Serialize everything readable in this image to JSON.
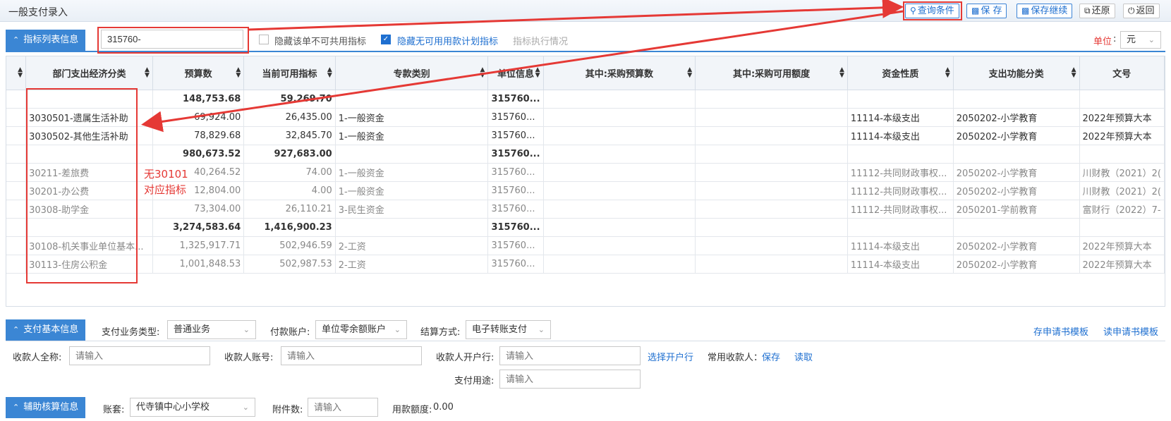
{
  "window": {
    "title": "一般支付录入"
  },
  "toolbar": {
    "query": "查询条件",
    "save": "保 存",
    "save_continue": "保存继续",
    "restore": "还原",
    "back": "返回"
  },
  "indicator_section": {
    "tab_label": "指标列表信息",
    "filter_value": "315760-",
    "hide_unshared_label": "隐藏该单不可共用指标",
    "hide_unshared_checked": false,
    "hide_unavailable_label": "隐藏无可用用款计划指标",
    "hide_unavailable_checked": true,
    "exec_status_label": "指标执行情况",
    "unit_label": "单位",
    "unit_value": "元"
  },
  "grid": {
    "columns": [
      "部门支出经济分类",
      "预算数",
      "当前可用指标",
      "专款类别",
      "单位信息",
      "其中:采购预算数",
      "其中:采购可用额度",
      "资金性质",
      "支出功能分类",
      "文号"
    ],
    "rows": [
      {
        "style": "bold",
        "cells": [
          "",
          "148,753.68",
          "59,269.70",
          "",
          "315760...",
          "",
          "",
          "",
          "",
          ""
        ]
      },
      {
        "style": "normal",
        "cells": [
          "3030501-遗属生活补助",
          "69,924.00",
          "26,435.00",
          "1-一般资金",
          "315760...",
          "",
          "",
          "11114-本级支出",
          "2050202-小学教育",
          "2022年预算大本"
        ]
      },
      {
        "style": "normal",
        "cells": [
          "3030502-其他生活补助",
          "78,829.68",
          "32,845.70",
          "1-一般资金",
          "315760...",
          "",
          "",
          "11114-本级支出",
          "2050202-小学教育",
          "2022年预算大本"
        ]
      },
      {
        "style": "bold",
        "cells": [
          "",
          "980,673.52",
          "927,683.00",
          "",
          "315760...",
          "",
          "",
          "",
          "",
          ""
        ]
      },
      {
        "style": "dim",
        "cells": [
          "30211-差旅费",
          "40,264.52",
          "74.00",
          "1-一般资金",
          "315760...",
          "",
          "",
          "11112-共同财政事权...",
          "2050202-小学教育",
          "川财教（2021）2("
        ]
      },
      {
        "style": "dim",
        "cells": [
          "30201-办公费",
          "12,804.00",
          "4.00",
          "1-一般资金",
          "315760...",
          "",
          "",
          "11112-共同财政事权...",
          "2050202-小学教育",
          "川财教（2021）2("
        ]
      },
      {
        "style": "dim",
        "cells": [
          "30308-助学金",
          "73,304.00",
          "26,110.21",
          "3-民生资金",
          "315760...",
          "",
          "",
          "11112-共同财政事权...",
          "2050201-学前教育",
          "富财行（2022）7-"
        ]
      },
      {
        "style": "bold",
        "cells": [
          "",
          "3,274,583.64",
          "1,416,900.23",
          "",
          "315760...",
          "",
          "",
          "",
          "",
          ""
        ]
      },
      {
        "style": "dim",
        "cells": [
          "30108-机关事业单位基本...",
          "1,325,917.71",
          "502,946.59",
          "2-工资",
          "315760...",
          "",
          "",
          "11114-本级支出",
          "2050202-小学教育",
          "2022年预算大本"
        ]
      },
      {
        "style": "dim",
        "cells": [
          "30113-住房公积金",
          "1,001,848.53",
          "502,987.53",
          "2-工资",
          "315760...",
          "",
          "",
          "11114-本级支出",
          "2050202-小学教育",
          "2022年预算大本"
        ]
      }
    ]
  },
  "annotation": {
    "line1": "无30101",
    "line2": "对应指标"
  },
  "payment_section": {
    "tab_label": "支付基本信息",
    "biz_type_label": "支付业务类型:",
    "biz_type_value": "普通业务",
    "pay_account_label": "付款账户:",
    "pay_account_value": "单位零余额账户",
    "settle_label": "结算方式:",
    "settle_value": "电子转账支付",
    "save_template": "存申请书模板",
    "read_template": "读申请书模板",
    "payee_name_label": "收款人全称:",
    "payee_account_label": "收款人账号:",
    "payee_bank_label": "收款人开户行:",
    "placeholder": "请输入",
    "choose_bank": "选择开户行",
    "frequent_payee_label": "常用收款人：",
    "frequent_save": "保存",
    "frequent_read": "读取",
    "purpose_label": "支付用途:"
  },
  "aux_section": {
    "tab_label": "辅助核算信息",
    "ledger_label": "账套:",
    "ledger_value": "代寺镇中心小学校",
    "attach_label": "附件数:",
    "amount_label": "用款额度:",
    "amount_value": "0.00"
  },
  "colors": {
    "accent": "#3b86d4",
    "annotation": "#e53935"
  }
}
